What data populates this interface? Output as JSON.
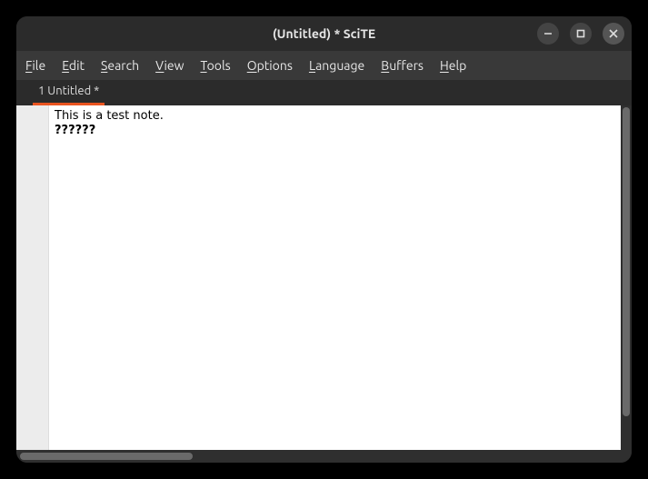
{
  "window": {
    "title": "(Untitled) * SciTE"
  },
  "menubar": {
    "items": [
      {
        "underline": "F",
        "rest": "ile"
      },
      {
        "underline": "E",
        "rest": "dit"
      },
      {
        "underline": "S",
        "rest": "earch"
      },
      {
        "underline": "V",
        "rest": "iew"
      },
      {
        "underline": "T",
        "rest": "ools"
      },
      {
        "underline": "O",
        "rest": "ptions"
      },
      {
        "underline": "L",
        "rest": "anguage"
      },
      {
        "underline": "B",
        "rest": "uffers"
      },
      {
        "underline": "H",
        "rest": "elp"
      }
    ]
  },
  "tabs": {
    "active": {
      "label": "1 Untitled *"
    }
  },
  "editor": {
    "line1": "This is a test note.",
    "line2": "??????"
  }
}
